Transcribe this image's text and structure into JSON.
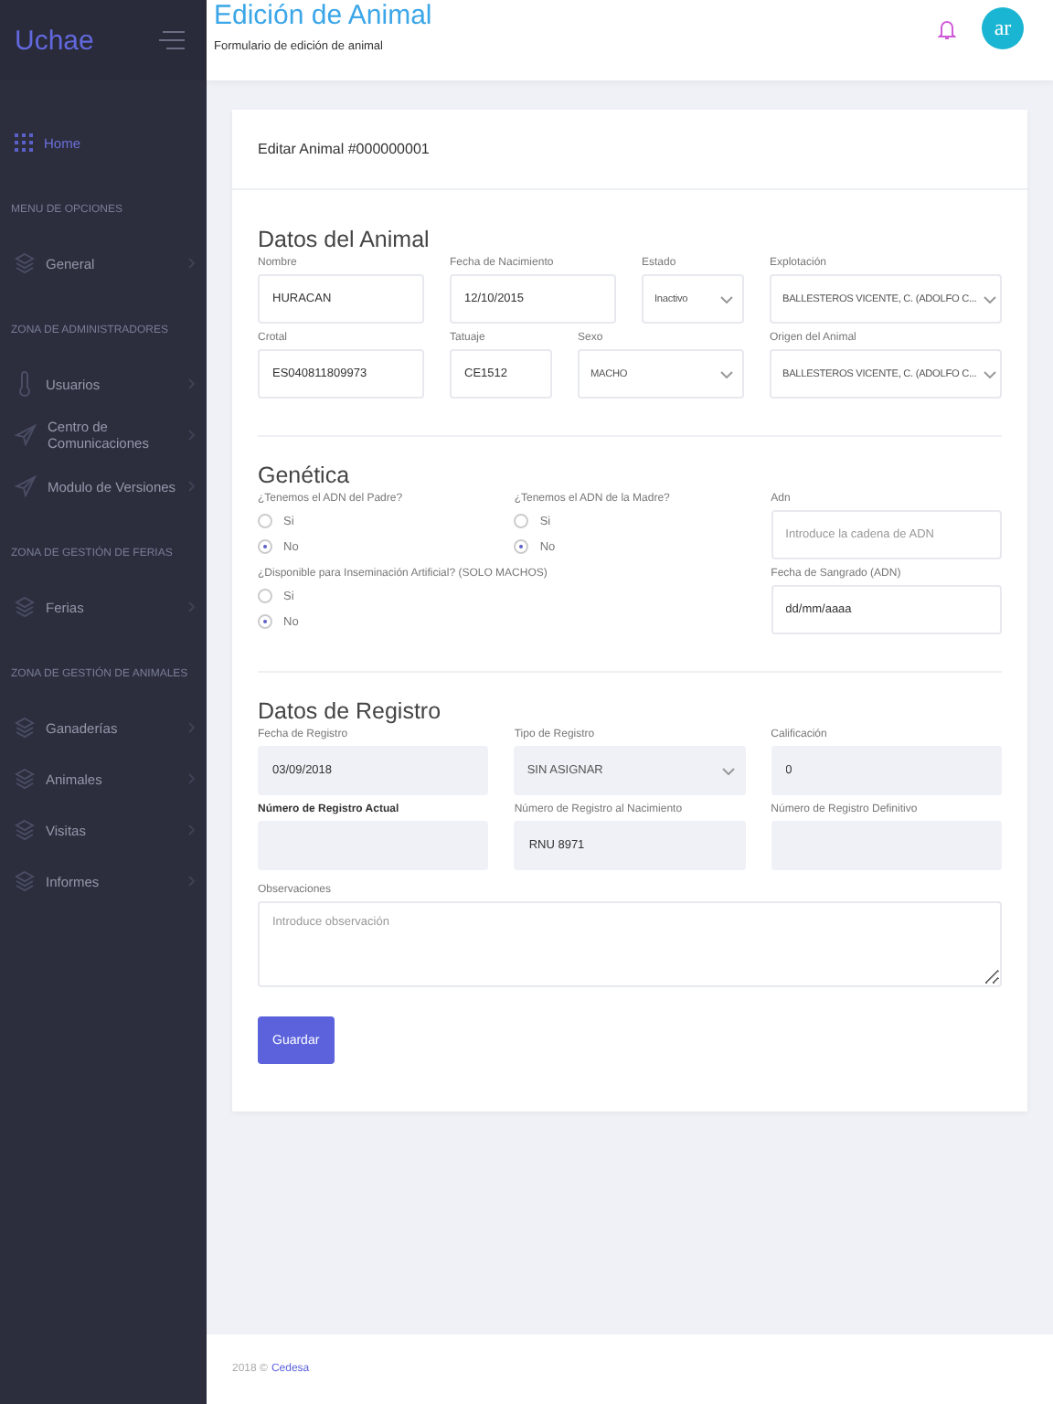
{
  "sidebar": {
    "brand": "Uchae",
    "home": {
      "label": "Home",
      "selected": true
    },
    "sections": [
      {
        "title": "MENU DE OPCIONES",
        "items": [
          {
            "label": "General",
            "selected": false
          }
        ]
      },
      {
        "title": "ZONA DE ADMINISTRADORES",
        "items": [
          {
            "label": "Usuarios",
            "selected": false
          },
          {
            "label": "Centro de Comunicaciones",
            "selected": false
          },
          {
            "label": "Modulo de Versiones",
            "selected": false
          }
        ]
      },
      {
        "title": "ZONA DE GESTIÓN DE FERIAS",
        "items": [
          {
            "label": "Ferias",
            "selected": false
          }
        ]
      },
      {
        "title": "ZONA DE GESTIÓN DE ANIMALES",
        "items": [
          {
            "label": "Ganaderías",
            "selected": false
          },
          {
            "label": "Animales",
            "selected": false
          },
          {
            "label": "Visitas",
            "selected": false
          },
          {
            "label": "Informes",
            "selected": false
          }
        ]
      }
    ]
  },
  "header": {
    "title": "Edición de Animal",
    "subtitle": "Formulario de edición de animal",
    "avatar": "ar"
  },
  "card": {
    "title": "Editar Animal #000000001",
    "animal": {
      "title": "Datos del Animal",
      "row_1": [
        {
          "kind": "text",
          "label": "Nombre",
          "value": "HURACAN"
        },
        {
          "kind": "text",
          "label": "Fecha de Nacimiento",
          "value": "12/10/2015"
        },
        {
          "kind": "select",
          "label": "Estado",
          "value": "Inactivo"
        },
        {
          "kind": "select",
          "label": "Explotación",
          "value": "BALLESTEROS VICENTE, C. (ADOLFO C..."
        }
      ],
      "row_2": [
        {
          "kind": "text",
          "label": "Crotal",
          "value": "ES040811809973"
        },
        {
          "kind": "text",
          "label": "Tatuaje",
          "value": "CE1512"
        },
        {
          "kind": "select",
          "label": "Sexo",
          "value": "MACHO"
        },
        {
          "kind": "select",
          "label": "Origen del Animal",
          "value": "BALLESTEROS VICENTE, C. (ADOLFO C..."
        }
      ]
    },
    "genetics": {
      "title": "Genética",
      "radio_groups": [
        {
          "label": "¿Tenemos el ADN del Padre?",
          "options": [
            {
              "label": "Si",
              "selected": false
            },
            {
              "label": "No",
              "selected": true
            }
          ]
        },
        {
          "label": "¿Tenemos el ADN de la Madre?",
          "options": [
            {
              "label": "Si",
              "selected": false
            },
            {
              "label": "No",
              "selected": true
            }
          ]
        },
        {
          "label": "¿Disponible para Inseminación Artificial? (SOLO MACHOS)",
          "options": [
            {
              "label": "Si",
              "selected": false
            },
            {
              "label": "No",
              "selected": true
            }
          ]
        }
      ],
      "fields": [
        {
          "kind": "text",
          "label": "Adn",
          "placeholder": "Introduce la cadena de ADN"
        },
        {
          "kind": "text",
          "label": "Fecha de Sangrado (ADN)",
          "value": "dd/mm/aaaa"
        }
      ]
    },
    "registry": {
      "title": "Datos de Registro",
      "fields": [
        {
          "kind": "text",
          "label": "Fecha de Registro",
          "value": "03/09/2018",
          "readonly": true,
          "label_bold": false
        },
        {
          "kind": "select",
          "label": "Tipo de Registro",
          "value": "SIN ASIGNAR",
          "readonly": true,
          "label_bold": false
        },
        {
          "kind": "text",
          "label": "Calificación",
          "value": "0",
          "readonly": true,
          "label_bold": false
        },
        {
          "kind": "text",
          "label": "Número de Registro Actual",
          "readonly": true,
          "label_bold": true
        },
        {
          "kind": "text",
          "label": "Número de Registro al Nacimiento",
          "value": "RNU 8971",
          "readonly": true,
          "label_bold": false
        },
        {
          "kind": "text",
          "label": "Número de Registro Definitivo",
          "readonly": true,
          "label_bold": false
        }
      ],
      "notes": {
        "label": "Observaciones",
        "placeholder": "Introduce observación"
      }
    },
    "save_button": "Guardar"
  },
  "footer": {
    "text": "2018 ©",
    "link": "Cedesa"
  }
}
